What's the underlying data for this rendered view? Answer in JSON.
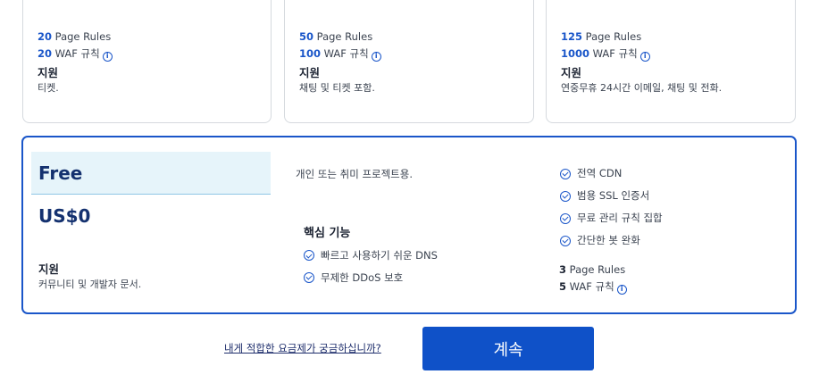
{
  "plans_top": [
    {
      "page_rules_num": "20",
      "page_rules_label": "Page Rules",
      "waf_num": "20",
      "waf_label": "WAF 규칙",
      "support_heading": "지원",
      "support_text": "티켓."
    },
    {
      "page_rules_num": "50",
      "page_rules_label": "Page Rules",
      "waf_num": "100",
      "waf_label": "WAF 규칙",
      "support_heading": "지원",
      "support_text": "채팅 및 티켓 포함."
    },
    {
      "page_rules_num": "125",
      "page_rules_label": "Page Rules",
      "waf_num": "1000",
      "waf_label": "WAF 규칙",
      "support_heading": "지원",
      "support_text": "연중무휴 24시간 이메일, 채팅 및 전화."
    }
  ],
  "free_plan": {
    "name": "Free",
    "price": "US$0",
    "description": "개인 또는 취미 프로젝트용.",
    "support_heading": "지원",
    "support_text": "커뮤니티 및 개발자 문서.",
    "core_heading": "핵심 기능",
    "core_features": [
      "빠르고 사용하기 쉬운 DNS",
      "무제한 DDoS 보호"
    ],
    "features": [
      "전역 CDN",
      "범용 SSL 인증서",
      "무료 관리 규칙 집합",
      "간단한 봇 완화"
    ],
    "page_rules_num": "3",
    "page_rules_label": "Page Rules",
    "waf_num": "5",
    "waf_label": "WAF 규칙"
  },
  "footer": {
    "help_link": "내게 적합한 요금제가 궁금하십니까?",
    "continue_label": "계속"
  },
  "colors": {
    "accent": "#1a56c9",
    "button": "#0f51c8",
    "header_bg": "#e6f4fa"
  }
}
